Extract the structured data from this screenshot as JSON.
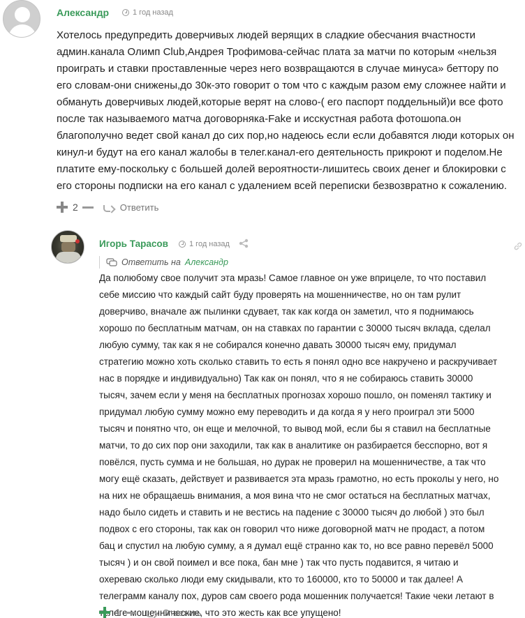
{
  "comment1": {
    "author": "Александр",
    "time": "1 год назад",
    "lines": [
      "Хотелось предупредить доверчивых людей верящих в сладкие обесчания вчастности",
      "админ.канала Олимп Club,Андрея Трофимова-сейчас плата за матчи по которым «нельзя",
      "проиграть и ставки проставленные через него возвращаются в случае минуса» беттору по",
      "его словам-они снижены,до 30к-это говорит о том что с каждым разом ему сложнее найти и",
      "обмануть доверчивых людей,которые верят на слово-( его паспорт поддельный)и все фото",
      "после так называемого матча договорняка-Fake и исскустная работа фотошопа.он",
      "благополучно ведет свой канал до сих пор,но надеюсь если если добавятся люди которых он",
      "кинул-и будут на его канал жалобы в телег.канал-его деятельность прикроют и поделом.Не",
      "платите ему-поскольку с большей долей вероятности-лишитесь своих денег и блокировки с",
      "его стороны подписки на его канал с удалением всей переписки безвозвратно к сожалению."
    ],
    "votes": "2",
    "reply_label": "Ответить"
  },
  "comment2": {
    "author": "Игорь Тарасов",
    "time": "1 год назад",
    "reply_to_label": "Ответить на",
    "reply_to_name": "Александр",
    "lines": [
      "Да полюбому свое получит эта мразь! Самое главное он уже вприцеле, то что поставил",
      "себе миссию что каждый сайт буду проверять на мошенничестве, но он там рулит",
      "доверчиво, вначале аж пылинки сдувает, так как когда он заметил, что я поднимаюсь",
      "хорошо по бесплатным матчам, он на ставках по гарантии с 30000 тысяч вклада, сделал",
      "любую сумму, так как я не собирался конечно давать 30000 тысяч ему, придумал",
      "стратегию можно хоть сколько ставить то есть я понял одно все накручено и раскручивает",
      "нас в порядке и индивидуально) Так как он понял, что я не собираюсь ставить 30000",
      "тысяч, зачем если у меня на бесплатных прогнозах хорошо пошло, он поменял тактику и",
      "придумал любую сумму можно ему переводить и да когда я у него проиграл эти 5000",
      "тысяч и понятно что, он еще и мелочной, то вывод мой, если бы я ставил на бесплатные",
      "матчи, то до сих пор они заходили, так как в аналитике он разбирается бесспорно, вот я",
      "повёлся, пусть сумма и не большая, но дурак не проверил на мошенничестве, а так что",
      "могу ещё сказать, действует и развивается эта мразь грамотно, но есть проколы у него, но",
      "на них не обращаешь внимания, а моя вина что не смог остаться на бесплатных матчах,",
      "надо было сидеть и ставить и не вестись на падение с 30000 тысяч до любой ) это был",
      "подвох с его стороны, так как он говорил что ниже договорной матч не продаст, а потом",
      "бац и спустил на любую сумму, а я думал ещё странно как то, но все равно перевёл 5000",
      "тысяч ) и он свой поимел и все пока, бан мне ) так что пусть подавится, я читаю и",
      "охереваю сколько люди ему скидывали, кто то 160000, кто то 50000 и так далее! А",
      "телеграмм каналу пох, дуров сам своего рода мошенник получается! Такие чеки летают в",
      "телеге мошеннические, что это жесть как все упущено!"
    ],
    "votes": "1",
    "reply_label": "Ответить"
  }
}
